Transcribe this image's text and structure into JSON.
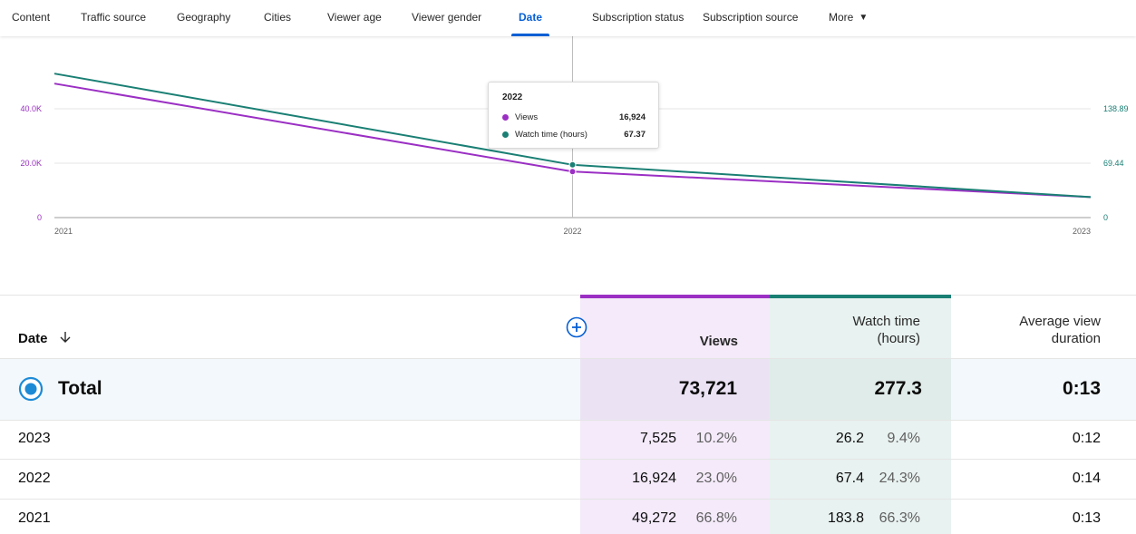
{
  "tabs": [
    {
      "label": "Content"
    },
    {
      "label": "Traffic source"
    },
    {
      "label": "Geography"
    },
    {
      "label": "Cities"
    },
    {
      "label": "Viewer age"
    },
    {
      "label": "Viewer gender"
    },
    {
      "label": "Date",
      "active": true
    },
    {
      "label": "Subscription status"
    },
    {
      "label": "Subscription source"
    },
    {
      "label": "More"
    }
  ],
  "colors": {
    "views": "#9b2fc4",
    "watch_time": "#1a7f74",
    "accent": "#065fd4",
    "views_bg": "#f4eaf9",
    "watch_bg": "#e8f2f0",
    "total_row_bg": "#f2f8fb"
  },
  "chart_data": {
    "type": "line",
    "x": [
      "2021",
      "2022",
      "2023"
    ],
    "series": [
      {
        "name": "Views",
        "values": [
          49272,
          16924,
          7525
        ],
        "axis": "left",
        "color": "#9b2fc4"
      },
      {
        "name": "Watch time (hours)",
        "values": [
          183.8,
          67.37,
          26.2
        ],
        "axis": "right",
        "color": "#1a7f74"
      }
    ],
    "left_axis": {
      "ticks": [
        "0",
        "20.0K",
        "40.0K"
      ],
      "ylim": [
        0,
        60000
      ]
    },
    "right_axis": {
      "ticks": [
        "0",
        "69.44",
        "138.89"
      ],
      "ylim": [
        0,
        208.33
      ]
    },
    "grid": true,
    "hover_x": "2022"
  },
  "tooltip": {
    "title": "2022",
    "rows": [
      {
        "label": "Views",
        "value": "16,924"
      },
      {
        "label": "Watch time (hours)",
        "value": "67.37"
      }
    ]
  },
  "table": {
    "headers": {
      "date": "Date",
      "views": "Views",
      "watch_time_line1": "Watch time",
      "watch_time_line2": "(hours)",
      "avg_line1": "Average view",
      "avg_line2": "duration"
    },
    "total": {
      "label": "Total",
      "views": "73,721",
      "watch_time": "277.3",
      "avg": "0:13"
    },
    "rows": [
      {
        "date": "2023",
        "views": "7,525",
        "views_pct": "10.2%",
        "watch": "26.2",
        "watch_pct": "9.4%",
        "avg": "0:12"
      },
      {
        "date": "2022",
        "views": "16,924",
        "views_pct": "23.0%",
        "watch": "67.4",
        "watch_pct": "24.3%",
        "avg": "0:14"
      },
      {
        "date": "2021",
        "views": "49,272",
        "views_pct": "66.8%",
        "watch": "183.8",
        "watch_pct": "66.3%",
        "avg": "0:13"
      }
    ]
  }
}
